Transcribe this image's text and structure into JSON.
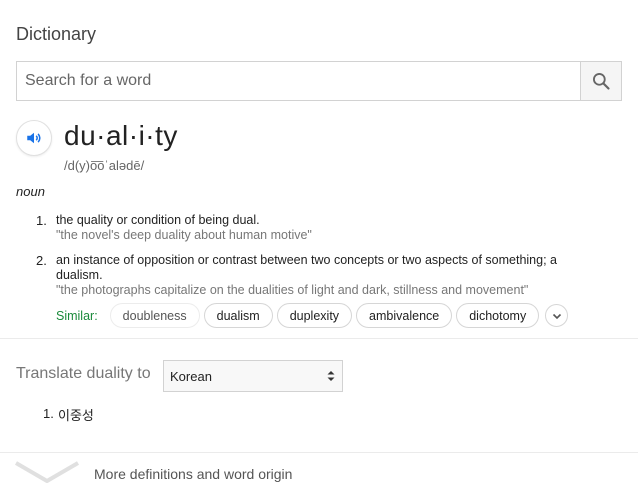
{
  "header": {
    "title": "Dictionary"
  },
  "search": {
    "placeholder": "Search for a word",
    "value": ""
  },
  "entry": {
    "word": "du·al·i·ty",
    "phonetic": "/d(y)o͞oˈalədē/",
    "part_of_speech": "noun",
    "definitions": [
      {
        "number": "1.",
        "text": "the quality or condition of being dual.",
        "example": "\"the novel's deep duality about human motive\""
      },
      {
        "number": "2.",
        "text": "an instance of opposition or contrast between two concepts or two aspects of something; a dualism.",
        "example": "\"the photographs capitalize on the dualities of light and dark, stillness and movement\""
      }
    ],
    "similar_label": "Similar:",
    "similar": [
      "doubleness",
      "dualism",
      "duplexity",
      "ambivalence",
      "dichotomy"
    ]
  },
  "translate": {
    "label": "Translate duality to",
    "language": "Korean",
    "results": [
      {
        "number": "1.",
        "text": "이중성"
      }
    ]
  },
  "footer": {
    "more_label": "More definitions and word origin"
  },
  "colors": {
    "similar_label": "#1a8a3a",
    "speaker_icon": "#1a73e8"
  }
}
